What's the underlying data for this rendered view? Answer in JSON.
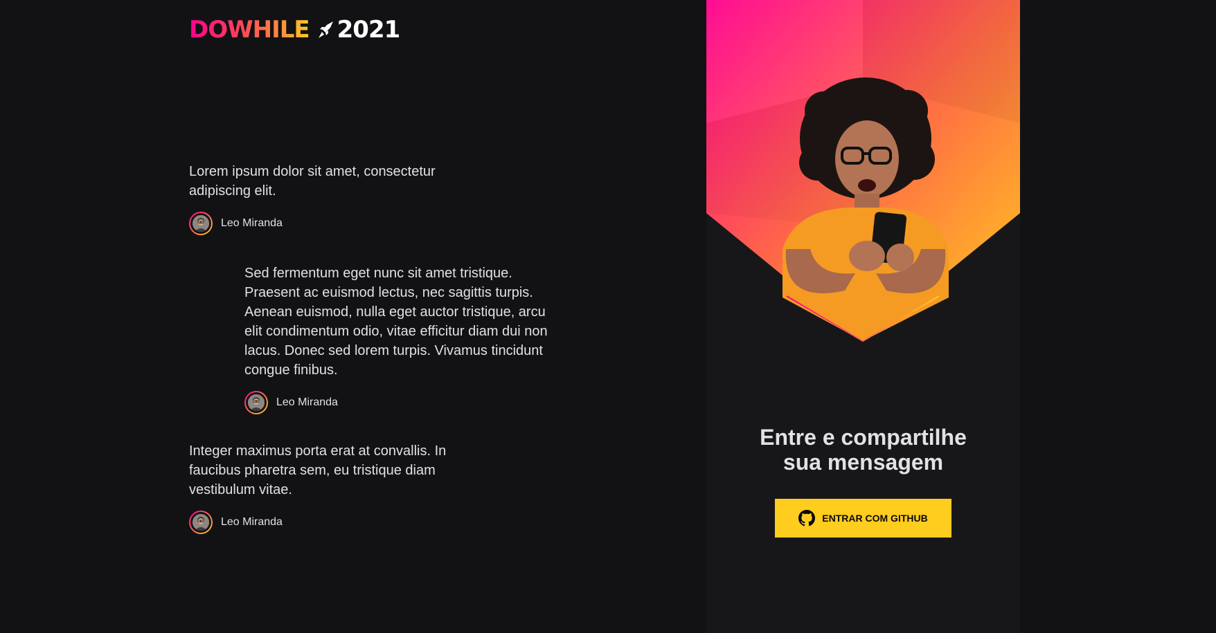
{
  "logo": {
    "wordmark": "DOWHILE",
    "year": "2021"
  },
  "messages": [
    {
      "text": "Lorem ipsum dolor sit amet, consectetur adipiscing elit.",
      "user": "Leo Miranda"
    },
    {
      "text": "Sed fermentum eget nunc sit amet tristique. Praesent ac euismod lectus, nec sagittis turpis. Aenean euismod, nulla eget auctor tristique, arcu elit condimentum odio, vitae efficitur diam dui non lacus. Donec sed lorem turpis. Vivamus tincidunt congue finibus.",
      "user": "Leo Miranda"
    },
    {
      "text": "Integer maximus porta erat at convallis. In faucibus pharetra sem, eu tristique diam vestibulum vitae.",
      "user": "Leo Miranda"
    }
  ],
  "panel": {
    "title_line1": "Entre e compartilhe",
    "title_line2": "sua mensagem",
    "button_label": "ENTRAR COM GITHUB",
    "button_icon": "github-icon"
  },
  "colors": {
    "background": "#121214",
    "panel": "#17171a",
    "brand_pink": "#ff008e",
    "brand_yellow": "#ffcd1e"
  }
}
